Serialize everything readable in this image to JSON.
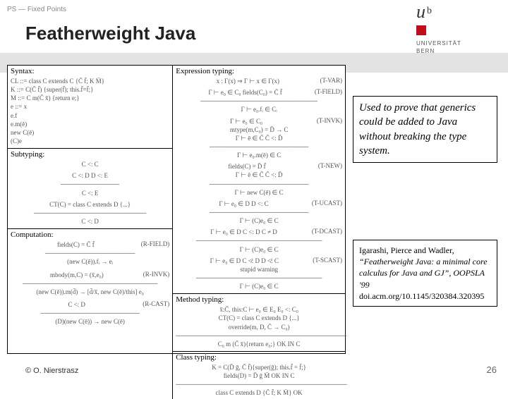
{
  "header": {
    "breadcrumb": "PS — Fixed Points",
    "title": "Featherweight Java",
    "logo": {
      "u": "u",
      "b": "b",
      "uni": "UNIVERSITÄT",
      "bern": "BERN"
    }
  },
  "figure": {
    "syntax": {
      "heading": "Syntax:",
      "body": "CL  ::=  class C extends C {C̄ f̄; K M̄}\nK   ::=  C(C̄ f̄) {super(f̄); this.f̄=f̄;}\nM   ::=  C m(C̄ x̄) {return e;}\ne   ::=  x\n        e.f\n        e.m(ē)\n        new C(ē)\n        (C)e"
    },
    "subtyping": {
      "heading": "Subtyping:",
      "body1": "C <: C",
      "body2": "C <: D    D <: E\n─────────────\n      C <: E",
      "body3": "CT(C) = class C extends D {...}\n─────────────────────────\n             C <: D"
    },
    "computation": {
      "heading": "Computation:",
      "r1": "fields(C) = C̄ f̄\n────────────────────\n(new C(ē)).fᵢ → eᵢ",
      "t1": "(R-FIELD)",
      "r2": "mbody(m,C) = (x̄,e₀)\n──────────────────────────────\n(new C(ē)).m(d̄) → [d̄/x̄, new C(ē)/this] e₀",
      "t2": "(R-INVK)",
      "r3": "C <: D\n──────────────────────\n(D)(new C(ē)) → new C(ē)",
      "t3": "(R-CAST)"
    },
    "expr": {
      "heading": "Expression typing:",
      "r1": "x : Γ(x)  ⇒  Γ ⊢ x ∈ Γ(x)",
      "t1": "(T-VAR)",
      "r2": "Γ ⊢ e₀ ∈ C₀    fields(C₀) = C̄ f̄\n──────────────────────────\n        Γ ⊢ e₀.fᵢ ∈ Cᵢ",
      "t2": "(T-FIELD)",
      "r3": "Γ ⊢ e₀ ∈ C₀\nmtype(m,C₀) = D̄ → C\nΓ ⊢ ē ∈ C̄    C̄ <: D̄\n──────────────────────\nΓ ⊢ e₀.m(ē) ∈ C",
      "t3": "(T-INVK)",
      "r4": "fields(C) = D̄ f̄\nΓ ⊢ ē ∈ C̄    C̄ <: D̄\n──────────────────────\nΓ ⊢ new C(ē) ∈ C",
      "t4": "(T-NEW)",
      "r5": "Γ ⊢ e₀ ∈ D    D <: C\n──────────────────────\nΓ ⊢ (C)e₀ ∈ C",
      "t5": "(T-UCAST)",
      "r6": "Γ ⊢ e₀ ∈ D    C <: D    C ≠ D\n────────────────────────────\nΓ ⊢ (C)e₀ ∈ C",
      "t6": "(T-DCAST)",
      "r7": "Γ ⊢ e₀ ∈ D    C ≮: D    D ≮: C\nstupid warning\n────────────────────────────\nΓ ⊢ (C)e₀ ∈ C",
      "t7": "(T-SCAST)"
    },
    "method": {
      "heading": "Method typing:",
      "body": "x̄:C̄, this:C ⊢ e₀ ∈ E₀    E₀ <: C₀\nCT(C) = class C extends D {...}\noverride(m, D, C̄ → C₀)\n──────────────────────────────────────\nC₀ m (C̄ x̄){return e₀;}  OK IN C"
    },
    "classt": {
      "heading": "Class typing:",
      "body": "K = C(D̄ ḡ, C̄ f̄){super(ḡ); this.f̄ = f̄;}\nfields(D) = D̄ ḡ       M̄ OK IN C\n──────────────────────────────────────\nclass C extends D {C̄ f̄; K M̄}  OK"
    }
  },
  "callout": "Used to prove that generics could be added to Java without breaking the type system.",
  "citation": {
    "authors": "Igarashi, Pierce and Wadler,",
    "title": "“Featherweight Java: a minimal core calculus for Java and GJ”,",
    "venue": "OOPSLA '99",
    "doi": "doi.acm.org/10.1145/320384.320395"
  },
  "footer": "© O. Nierstrasz",
  "page": "26"
}
